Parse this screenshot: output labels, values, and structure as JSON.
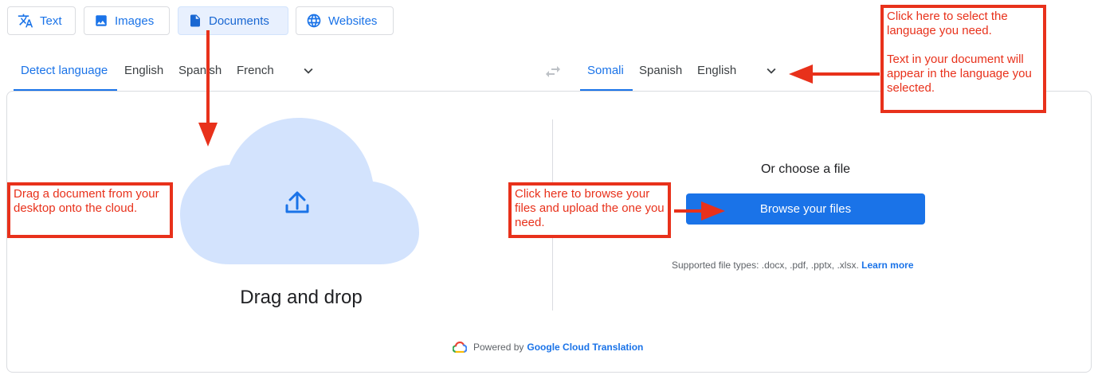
{
  "mode_tabs": [
    {
      "label": "Text",
      "icon": "translate-icon"
    },
    {
      "label": "Images",
      "icon": "image-icon"
    },
    {
      "label": "Documents",
      "icon": "document-icon"
    },
    {
      "label": "Websites",
      "icon": "globe-icon"
    }
  ],
  "source_languages": [
    "Detect language",
    "English",
    "Spanish",
    "French"
  ],
  "target_languages": [
    "Somali",
    "Spanish",
    "English"
  ],
  "upload": {
    "drag_title": "Drag and drop"
  },
  "file_picker": {
    "title": "Or choose a file",
    "browse_label": "Browse your files",
    "supported_text": "Supported file types: .docx, .pdf, .pptx, .xlsx.",
    "learn_more": "Learn more"
  },
  "footer": {
    "powered_by": "Powered by",
    "link": "Google Cloud Translation"
  },
  "annotations": {
    "language": {
      "line1": "Click here to select the language you need.",
      "line2": "Text in your document will appear in the language you selected."
    },
    "drag": "Drag a document from your desktop onto the cloud.",
    "browse": "Click here to browse your files and upload the one you need."
  },
  "colors": {
    "accent": "#1a73e8",
    "annotation": "#e8311b",
    "cloud": "#d3e3fd"
  }
}
